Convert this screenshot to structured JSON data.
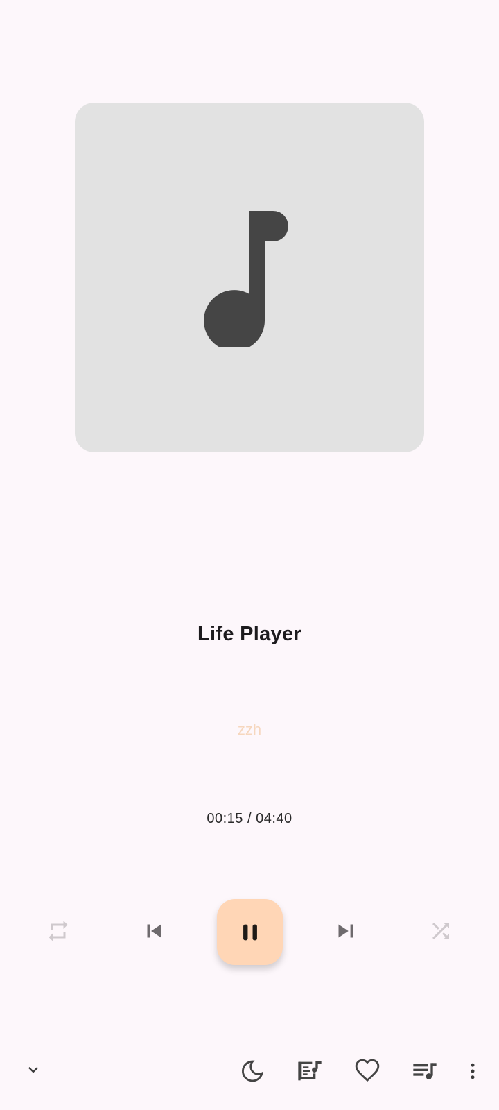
{
  "player": {
    "title": "Life Player",
    "artist": "zzh",
    "time": "00:15 / 04:40"
  },
  "colors": {
    "background": "#FDF7FB",
    "artwork_bg": "#E2E2E2",
    "note_icon": "#454545",
    "play_button": "#FFD6B6",
    "artist_text": "#F6D7BE"
  },
  "controls": {
    "repeat_icon": "repeat-icon",
    "previous_icon": "skip-previous-icon",
    "play_pause_icon": "pause-icon",
    "next_icon": "skip-next-icon",
    "shuffle_icon": "shuffle-icon"
  },
  "bottom_bar": {
    "collapse_icon": "chevron-down-icon",
    "sleep_timer_icon": "moon-icon",
    "lyrics_icon": "lyrics-icon",
    "favorite_icon": "heart-icon",
    "queue_icon": "queue-music-icon",
    "more_icon": "more-vert-icon"
  }
}
